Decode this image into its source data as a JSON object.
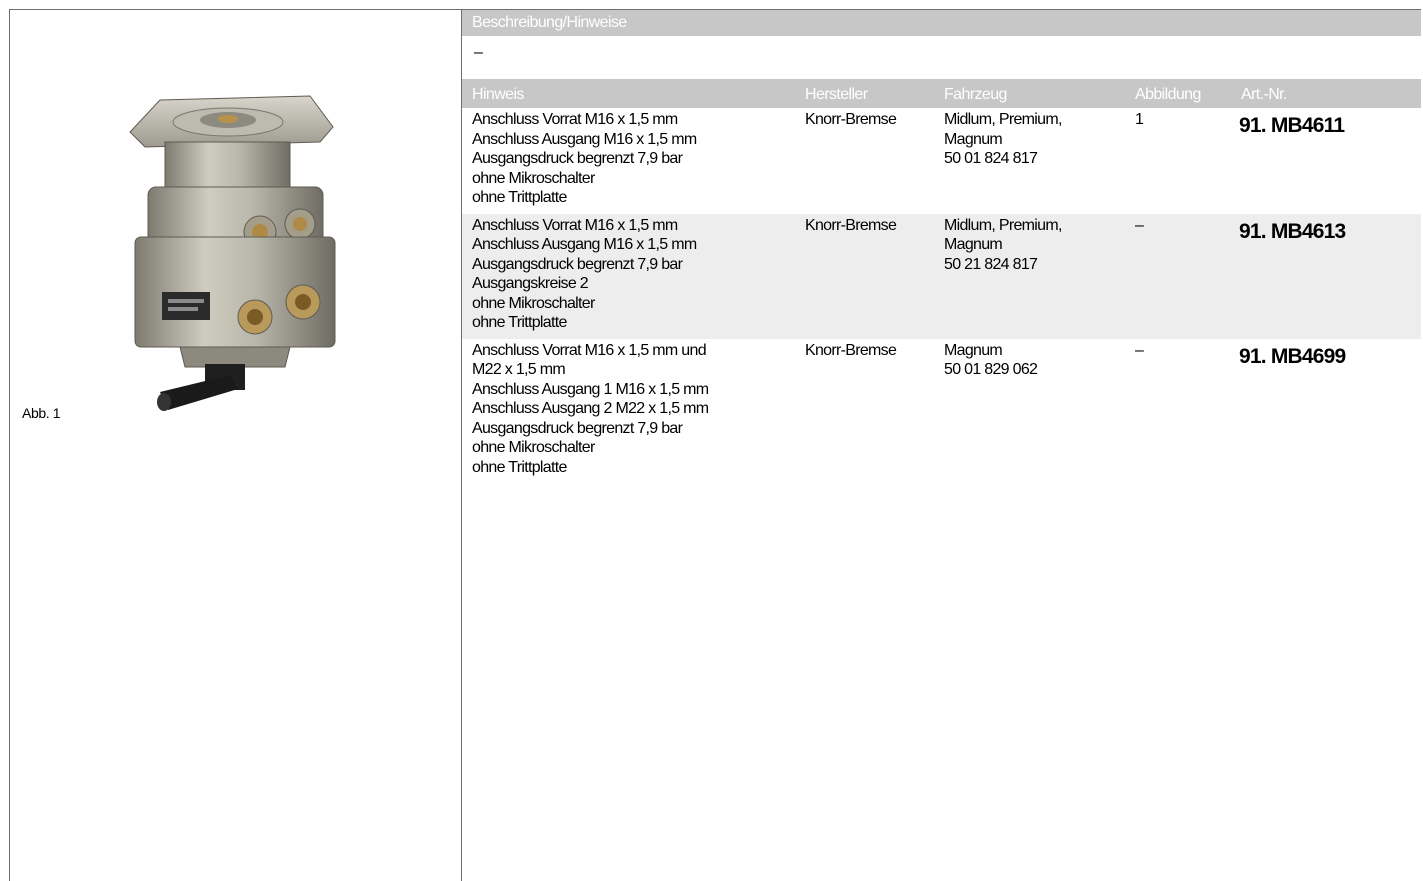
{
  "figure": {
    "label": "Abb. 1"
  },
  "description": {
    "header": "Beschreibung/Hinweise",
    "value": "–"
  },
  "table": {
    "columns": [
      "Hinweis",
      "Hersteller",
      "Fahrzeug",
      "Abbildung",
      "Art.-Nr."
    ],
    "rows": [
      {
        "hinweis": [
          "Anschluss Vorrat M16 x 1,5 mm",
          "Anschluss Ausgang M16 x 1,5 mm",
          "Ausgangsdruck begrenzt 7,9 bar",
          "ohne Mikroschalter",
          "ohne Trittplatte"
        ],
        "hersteller": "Knorr-Bremse",
        "fahrzeug": [
          "Midlum, Premium,",
          "Magnum",
          "50 01 824 817"
        ],
        "abbildung": "1",
        "art_nr": "91. MB4611"
      },
      {
        "hinweis": [
          "Anschluss Vorrat M16 x 1,5 mm",
          "Anschluss Ausgang M16 x 1,5 mm",
          "Ausgangsdruck begrenzt 7,9 bar",
          "Ausgangskreise 2",
          "ohne Mikroschalter",
          "ohne Trittplatte"
        ],
        "hersteller": "Knorr-Bremse",
        "fahrzeug": [
          "Midlum, Premium,",
          "Magnum",
          "50 21 824 817"
        ],
        "abbildung": "–",
        "art_nr": "91. MB4613"
      },
      {
        "hinweis": [
          "Anschluss Vorrat M16 x 1,5 mm und",
          "M22 x 1,5 mm",
          "Anschluss Ausgang 1 M16 x 1,5 mm",
          "Anschluss Ausgang 2 M22 x 1,5 mm",
          "Ausgangsdruck begrenzt 7,9 bar",
          "ohne Mikroschalter",
          "ohne Trittplatte"
        ],
        "hersteller": "Knorr-Bremse",
        "fahrzeug": [
          "Magnum",
          "50 01 829 062"
        ],
        "abbildung": "–",
        "art_nr": "91. MB4699"
      }
    ]
  }
}
